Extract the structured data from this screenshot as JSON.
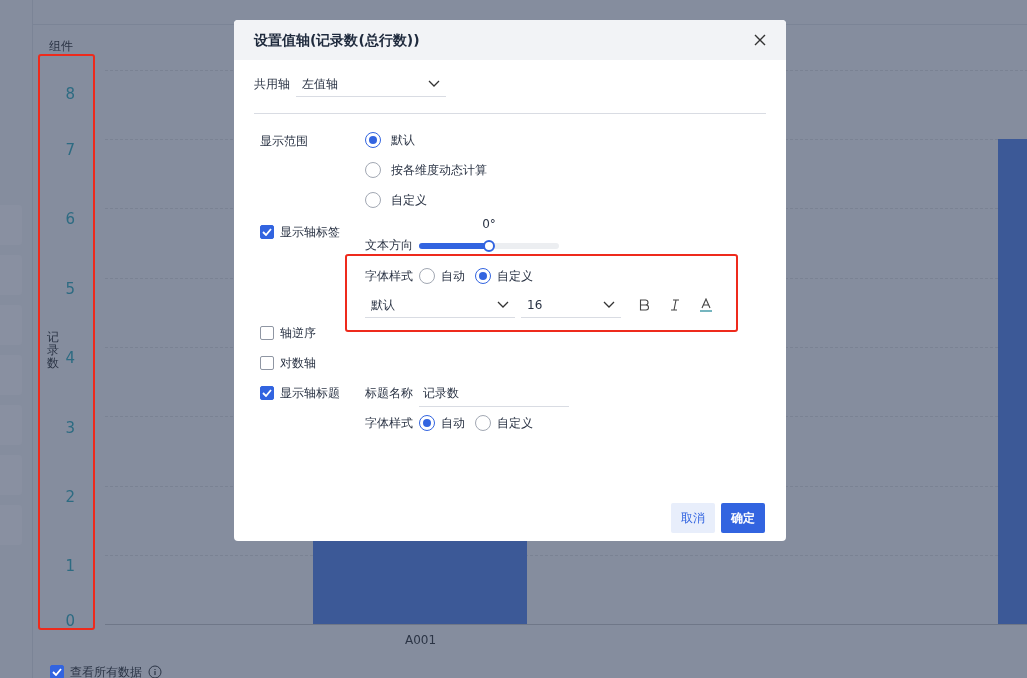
{
  "chart": {
    "corner_label": "组件",
    "y_axis_title": "记录数",
    "y_ticks": [
      "8",
      "7",
      "6",
      "5",
      "4",
      "3",
      "2",
      "1",
      "0"
    ],
    "x_labels": [
      "A001"
    ]
  },
  "view_all": {
    "label": "查看所有数据",
    "checked": true
  },
  "dialog": {
    "title": "设置值轴(记录数(总行数))",
    "shared_axis": {
      "label": "共用轴",
      "value": "左值轴"
    },
    "display_range": {
      "label": "显示范围",
      "options": [
        {
          "label": "默认",
          "selected": true
        },
        {
          "label": "按各维度动态计算",
          "selected": false
        },
        {
          "label": "自定义",
          "selected": false
        }
      ]
    },
    "axis_labels": {
      "label": "显示轴标签",
      "checked": true,
      "angle": "0°",
      "direction_label": "文本方向",
      "level": 0.5,
      "font_style": {
        "label": "字体样式",
        "options": [
          {
            "label": "自动",
            "selected": false
          },
          {
            "label": "自定义",
            "selected": true
          }
        ]
      },
      "font_family": "默认",
      "font_size": "16"
    },
    "reverse": {
      "label": "轴逆序",
      "checked": false
    },
    "log_axis": {
      "label": "对数轴",
      "checked": false
    },
    "axis_title": {
      "label": "显示轴标题",
      "checked": true,
      "name_label": "标题名称",
      "name_value": "记录数",
      "font_style": {
        "label": "字体样式",
        "options": [
          {
            "label": "自动",
            "selected": true
          },
          {
            "label": "自定义",
            "selected": false
          }
        ]
      }
    },
    "buttons": [
      {
        "label": "取消",
        "kind": "secondary"
      },
      {
        "label": "确定",
        "kind": "primary"
      }
    ]
  }
}
